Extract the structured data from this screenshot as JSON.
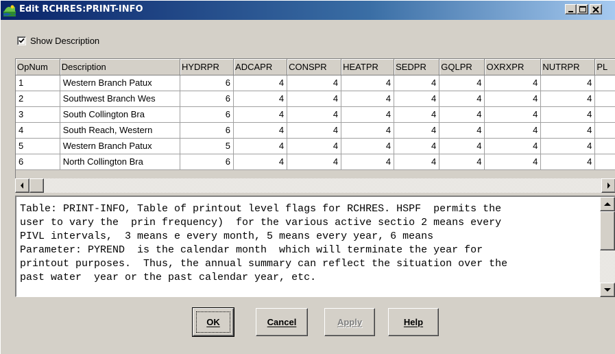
{
  "window": {
    "title": "Edit RCHRES:PRINT-INFO",
    "minimize_glyph": "minimize-icon",
    "maximize_glyph": "maximize-icon",
    "close_glyph": "close-icon"
  },
  "show_description": {
    "label": "Show Description",
    "checked": true
  },
  "grid": {
    "columns": [
      "OpNum",
      "Description",
      "HYDRPR",
      "ADCAPR",
      "CONSPR",
      "HEATPR",
      "SEDPR",
      "GQLPR",
      "OXRXPR",
      "NUTRPR",
      "PL"
    ],
    "rows": [
      [
        "1",
        "Western Branch Patux",
        "6",
        "4",
        "4",
        "4",
        "4",
        "4",
        "4",
        "4",
        ""
      ],
      [
        "2",
        "Southwest Branch Wes",
        "6",
        "4",
        "4",
        "4",
        "4",
        "4",
        "4",
        "4",
        ""
      ],
      [
        "3",
        "South Collington Bra",
        "6",
        "4",
        "4",
        "4",
        "4",
        "4",
        "4",
        "4",
        ""
      ],
      [
        "4",
        "South Reach, Western",
        "6",
        "4",
        "4",
        "4",
        "4",
        "4",
        "4",
        "4",
        ""
      ],
      [
        "5",
        "Western Branch Patux",
        "5",
        "4",
        "4",
        "4",
        "4",
        "4",
        "4",
        "4",
        ""
      ],
      [
        "6",
        "North Collington Bra",
        "6",
        "4",
        "4",
        "4",
        "4",
        "4",
        "4",
        "4",
        ""
      ]
    ]
  },
  "description": {
    "lines": [
      "Table: PRINT-INFO, Table of printout level flags for RCHRES. HSPF  permits the",
      "user to vary the  prin frequency)  for the various active sectio 2 means every",
      "PIVL intervals,  3 means e every month, 5 means every year, 6 means",
      "Parameter: PYREND  is the calendar month  which will terminate the year for",
      "printout purposes.  Thus, the annual summary can reflect the situation over the",
      "past water  year or the past calendar year, etc."
    ]
  },
  "buttons": {
    "ok": "OK",
    "cancel": "Cancel",
    "apply": "Apply",
    "help": "Help"
  }
}
